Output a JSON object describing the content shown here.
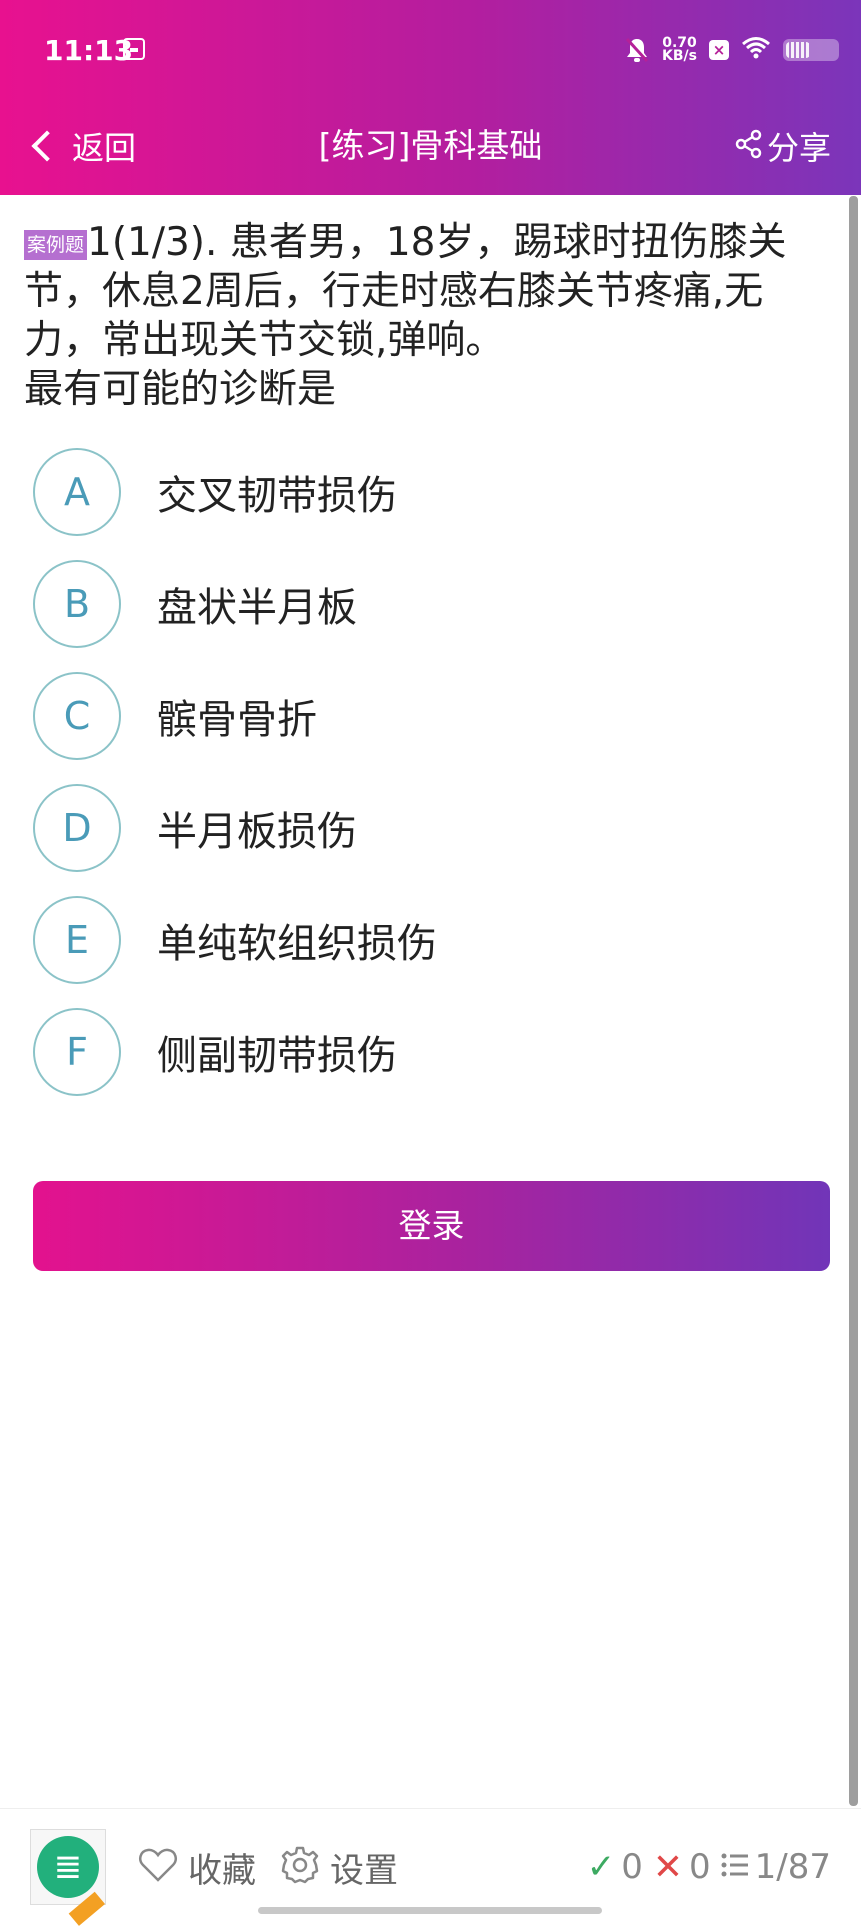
{
  "status_bar": {
    "time": "11:13",
    "net_speed_value": "0.70",
    "net_speed_unit": "KB/s"
  },
  "nav": {
    "back_label": "返回",
    "title": "[练习]骨科基础",
    "share_label": "分享"
  },
  "question": {
    "tag": "案例题",
    "prefix": "1(1/3).",
    "stem": " 患者男，18岁，踢球时扭伤膝关节，休息2周后，行走时感右膝关节疼痛,无力，常出现关节交锁,弹响。",
    "prompt": "最有可能的诊断是"
  },
  "options": [
    {
      "letter": "A",
      "text": "交叉韧带损伤"
    },
    {
      "letter": "B",
      "text": "盘状半月板"
    },
    {
      "letter": "C",
      "text": "髌骨骨折"
    },
    {
      "letter": "D",
      "text": "半月板损伤"
    },
    {
      "letter": "E",
      "text": "单纯软组织损伤"
    },
    {
      "letter": "F",
      "text": "侧副韧带损伤"
    }
  ],
  "login_button": "登录",
  "bottom_bar": {
    "favorite_label": "收藏",
    "settings_label": "设置",
    "correct_count": "0",
    "wrong_count": "0",
    "progress": "1/87"
  },
  "colors": {
    "header_gradient_start": "#e8118f",
    "header_gradient_end": "#7b35ba",
    "option_letter": "#4a9bb8",
    "case_tag": "#b56fd0",
    "correct": "#3daa62",
    "wrong": "#e04848"
  }
}
